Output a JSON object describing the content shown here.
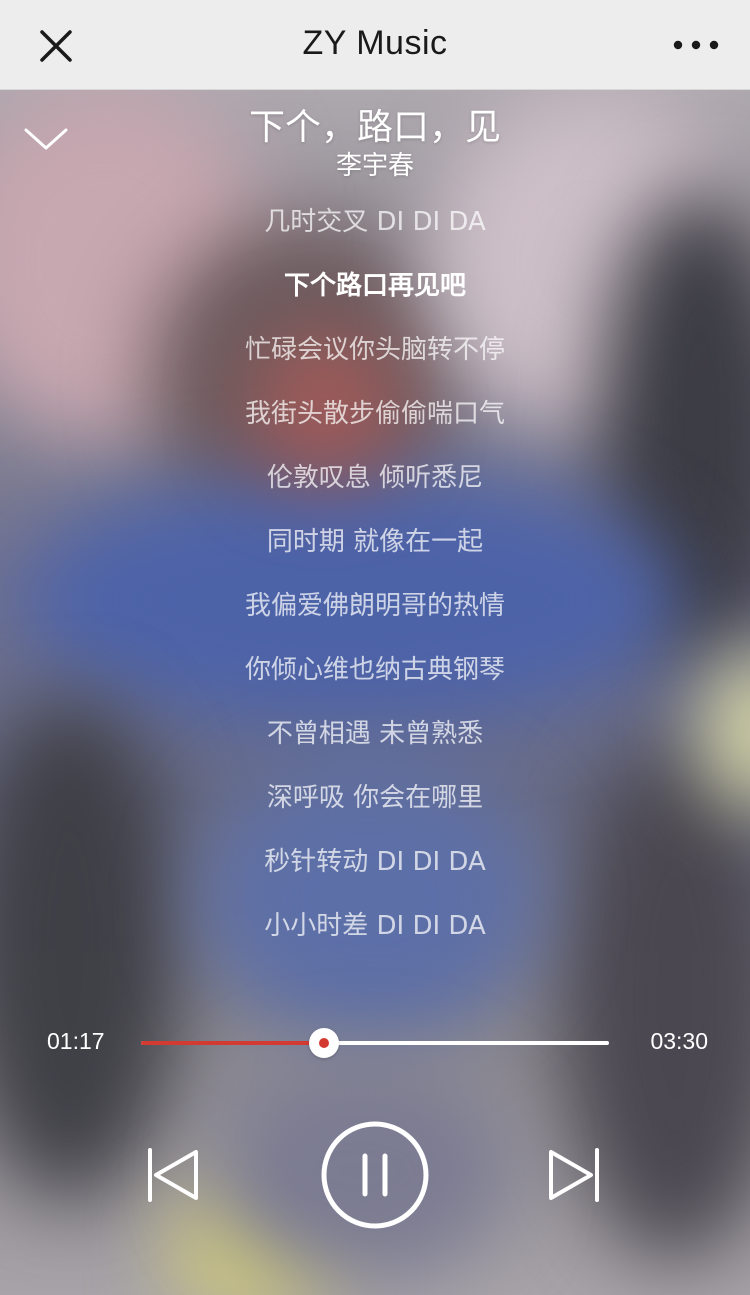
{
  "navbar": {
    "title": "ZY Music",
    "close_icon": "close-icon",
    "more_icon": "more-horizontal-icon"
  },
  "player": {
    "collapse_icon": "chevron-down-icon",
    "song_title": "下个，路口，见",
    "artist": "李宇春"
  },
  "lyrics": {
    "active_index": 1,
    "lines": [
      "几时交叉 DI DI DA",
      "下个路口再见吧",
      "忙碌会议你头脑转不停",
      "我街头散步偷偷喘口气",
      "伦敦叹息 倾听悉尼",
      "同时期 就像在一起",
      "我偏爱佛朗明哥的热情",
      "你倾心维也纳古典钢琴",
      "不曾相遇 未曾熟悉",
      "深呼吸 你会在哪里",
      "秒针转动 DI DI DA",
      "小小时差 DI DI DA"
    ]
  },
  "progress": {
    "current_time": "01:17",
    "total_time": "03:30",
    "fraction": 0.39,
    "fill_color": "#d33a31",
    "track_color": "#ffffff"
  },
  "controls": {
    "prev_icon": "skip-previous-icon",
    "play_pause_icon": "pause-icon",
    "next_icon": "skip-next-icon",
    "state": "playing"
  }
}
